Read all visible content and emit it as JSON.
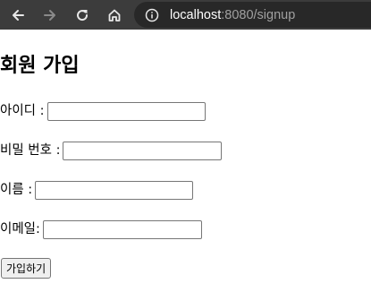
{
  "browser": {
    "icons": {
      "back": "arrow-left-icon",
      "forward": "arrow-right-icon",
      "reload": "reload-icon",
      "home": "home-icon",
      "site_info": "info-icon"
    },
    "address": {
      "host": "localhost",
      "rest": ":8080/signup"
    },
    "colors": {
      "toolbar": "#3c3c3c",
      "omnibox": "#282828",
      "url_host": "#ffffff",
      "url_rest": "#a0a0a0",
      "icon_active": "#e8e8e8",
      "icon_disabled": "#8a8a8a"
    }
  },
  "page": {
    "title": "회원 가입",
    "fields": {
      "id": {
        "label": "아이디 :",
        "value": "",
        "placeholder": ""
      },
      "password": {
        "label": "비밀 번호 :",
        "value": "",
        "placeholder": ""
      },
      "name": {
        "label": "이름 :",
        "value": "",
        "placeholder": ""
      },
      "email": {
        "label": "이메일:",
        "value": "",
        "placeholder": ""
      }
    },
    "submit_label": "가입하기"
  }
}
